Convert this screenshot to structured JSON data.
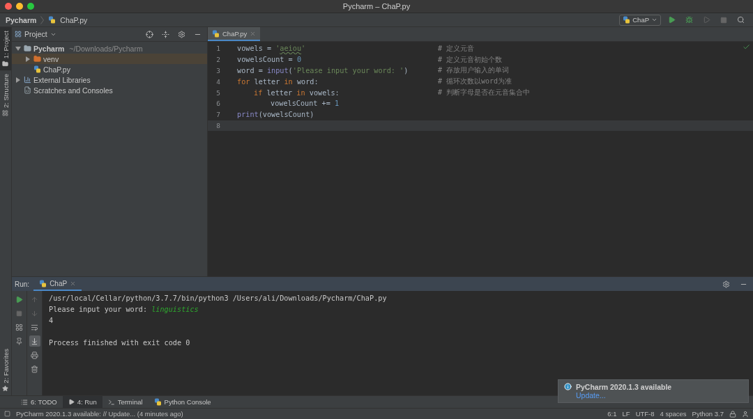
{
  "window": {
    "title": "Pycharm – ChaP.py"
  },
  "nav": {
    "breadcrumbs": [
      "Pycharm",
      "ChaP.py"
    ],
    "run_config": "ChaP"
  },
  "side_stripe": {
    "top": [
      {
        "label": "1: Project",
        "kind": "project",
        "selected": true
      },
      {
        "label": "2: Structure",
        "kind": "structure",
        "selected": false
      }
    ],
    "bottom": [
      {
        "label": "2: Favorites",
        "kind": "favorites",
        "selected": false
      }
    ]
  },
  "project": {
    "title": "Project",
    "tree": [
      {
        "label": "Pycharm",
        "path": "~/Downloads/Pycharm",
        "kind": "folder",
        "expanded": true,
        "selected": false,
        "children": [
          {
            "label": "venv",
            "kind": "venv",
            "expanded": false,
            "selected": true
          },
          {
            "label": "ChaP.py",
            "kind": "python",
            "selected": false
          }
        ]
      },
      {
        "label": "External Libraries",
        "kind": "libraries",
        "expanded": false,
        "selected": false
      },
      {
        "label": "Scratches and Consoles",
        "kind": "scratches",
        "selected": false
      }
    ]
  },
  "editor": {
    "tabs": [
      {
        "label": "ChaP.py",
        "selected": true
      }
    ],
    "lines": [
      {
        "number": "1",
        "current": false,
        "tokens": [
          {
            "kind": "plain",
            "text": "vowels = "
          },
          {
            "kind": "string",
            "text": "'"
          },
          {
            "kind": "typo",
            "text": "aeiou"
          },
          {
            "kind": "string",
            "text": "'"
          }
        ],
        "comment": "# 定义元音"
      },
      {
        "number": "2",
        "current": false,
        "tokens": [
          {
            "kind": "plain",
            "text": "vowelsCount = "
          },
          {
            "kind": "number",
            "text": "0"
          }
        ],
        "comment": "# 定义元音初始个数"
      },
      {
        "number": "3",
        "current": false,
        "tokens": [
          {
            "kind": "plain",
            "text": "word = "
          },
          {
            "kind": "builtin",
            "text": "input"
          },
          {
            "kind": "plain",
            "text": "("
          },
          {
            "kind": "string",
            "text": "'Please input your word: '"
          },
          {
            "kind": "plain",
            "text": ")"
          }
        ],
        "comment": "# 存放用户输入的单词"
      },
      {
        "number": "4",
        "current": false,
        "tokens": [
          {
            "kind": "keyword",
            "text": "for"
          },
          {
            "kind": "plain",
            "text": " letter "
          },
          {
            "kind": "keyword",
            "text": "in"
          },
          {
            "kind": "plain",
            "text": " word:"
          }
        ],
        "comment": "# 循环次数以word为准",
        "children": [
          {
            "number": "5",
            "current": false,
            "tokens": [
              {
                "kind": "keyword",
                "text": "if"
              },
              {
                "kind": "plain",
                "text": " letter "
              },
              {
                "kind": "keyword",
                "text": "in"
              },
              {
                "kind": "plain",
                "text": " vowels:"
              }
            ],
            "comment": "# 判断字母是否在元音集合中",
            "children": [
              {
                "number": "6",
                "current": false,
                "tokens": [
                  {
                    "kind": "plain",
                    "text": "vowelsCount += "
                  },
                  {
                    "kind": "number",
                    "text": "1"
                  }
                ]
              }
            ]
          }
        ]
      },
      {
        "number": "7",
        "current": false,
        "tokens": [
          {
            "kind": "builtin",
            "text": "print"
          },
          {
            "kind": "plain",
            "text": "(vowelsCount)"
          }
        ]
      },
      {
        "number": "8",
        "current": true
      }
    ]
  },
  "run": {
    "title": "Run:",
    "tabs": [
      {
        "label": "ChaP",
        "selected": true
      }
    ],
    "scroll_to_end": true,
    "console": [
      {
        "kind": "text",
        "segments": [
          {
            "kind": "output",
            "text": "/usr/local/Cellar/python/3.7.7/bin/python3 /Users/ali/Downloads/Pycharm/ChaP.py"
          }
        ]
      },
      {
        "kind": "text",
        "segments": [
          {
            "kind": "output",
            "text": "Please input your word: "
          },
          {
            "kind": "input",
            "text": "linguistics"
          }
        ]
      },
      {
        "kind": "text",
        "segments": [
          {
            "kind": "output",
            "text": "4"
          }
        ]
      },
      {
        "kind": "blank"
      },
      {
        "kind": "text",
        "segments": [
          {
            "kind": "output",
            "text": "Process finished with exit code 0"
          }
        ]
      }
    ]
  },
  "tool_tabs": [
    {
      "label": "6: TODO",
      "kind": "list",
      "selected": false
    },
    {
      "label": "4: Run",
      "kind": "run",
      "selected": true
    },
    {
      "label": "Terminal",
      "kind": "terminal",
      "selected": false
    },
    {
      "label": "Python Console",
      "kind": "python",
      "selected": false
    }
  ],
  "status": {
    "message": "PyCharm 2020.1.3 available: // Update... (4 minutes ago)",
    "items": [
      "6:1",
      "LF",
      "UTF-8",
      "4 spaces",
      "Python 3.7"
    ]
  },
  "notification": {
    "title": "PyCharm 2020.1.3 available",
    "link": "Update..."
  }
}
